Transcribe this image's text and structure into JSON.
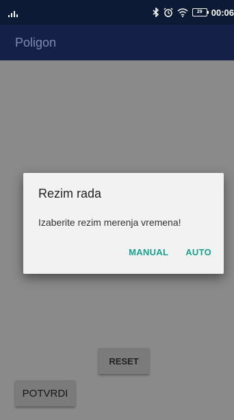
{
  "status_bar": {
    "signal_icon": "signal-bars-icon",
    "bluetooth_icon": "bluetooth-icon",
    "alarm_icon": "alarm-clock-icon",
    "wifi_icon": "wifi-icon",
    "battery_level": "29",
    "time": "00:06"
  },
  "app_bar": {
    "title": "Poligon",
    "color": "#142047"
  },
  "dialog": {
    "title": "Rezim rada",
    "message": "Izaberite rezim merenja vremena!",
    "actions": [
      {
        "label": "MANUAL"
      },
      {
        "label": "AUTO"
      }
    ],
    "accent_color": "#14a38b"
  },
  "buttons": {
    "reset_label": "RESET",
    "confirm_label": "POTVRDI"
  }
}
